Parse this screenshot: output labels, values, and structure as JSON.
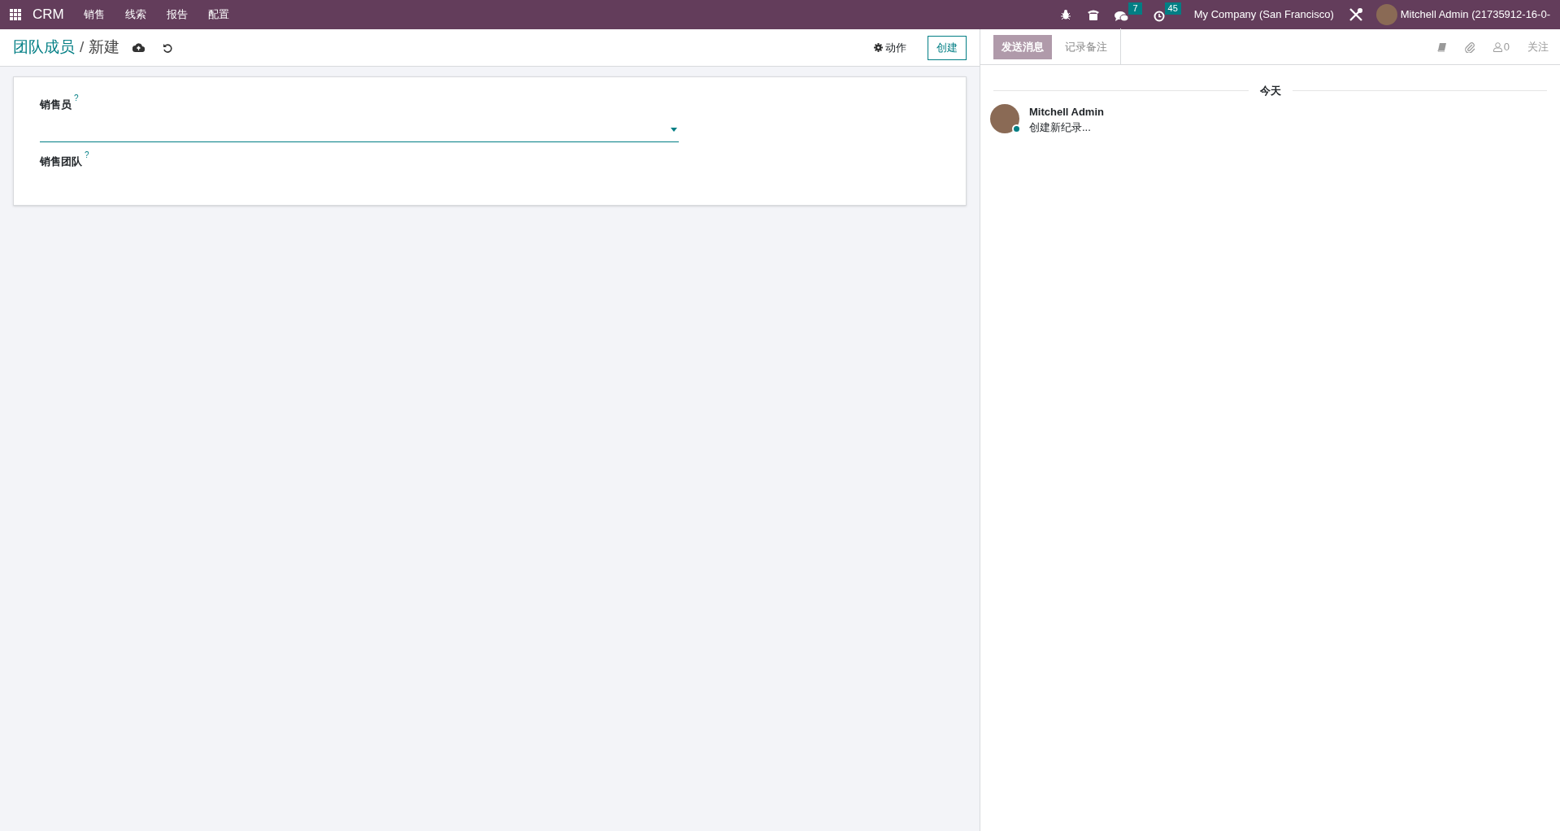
{
  "navbar": {
    "app_name": "CRM",
    "menu": [
      {
        "label": "销售"
      },
      {
        "label": "线索"
      },
      {
        "label": "报告"
      },
      {
        "label": "配置"
      }
    ],
    "messages_badge": "7",
    "activities_badge": "45",
    "company": "My Company (San Francisco)",
    "user": "Mitchell Admin (21735912-16-0-"
  },
  "breadcrumb": {
    "parent": "团队成员",
    "separator": "/",
    "current": "新建"
  },
  "actions": {
    "action_menu": "动作",
    "create_button": "创建"
  },
  "form": {
    "fields": [
      {
        "label": "销售员",
        "help": "?",
        "kind": "many2one"
      },
      {
        "label": "销售团队",
        "help": "?",
        "kind": "readonly"
      }
    ]
  },
  "chatter": {
    "tabs": [
      {
        "label": "发送消息",
        "selected": true
      },
      {
        "label": "记录备注",
        "selected": false
      }
    ],
    "followers_count": "0",
    "follow": "关注",
    "date_separator": "今天",
    "messages": [
      {
        "author": "Mitchell Admin",
        "body": "创建新纪录...",
        "online": true
      }
    ]
  }
}
